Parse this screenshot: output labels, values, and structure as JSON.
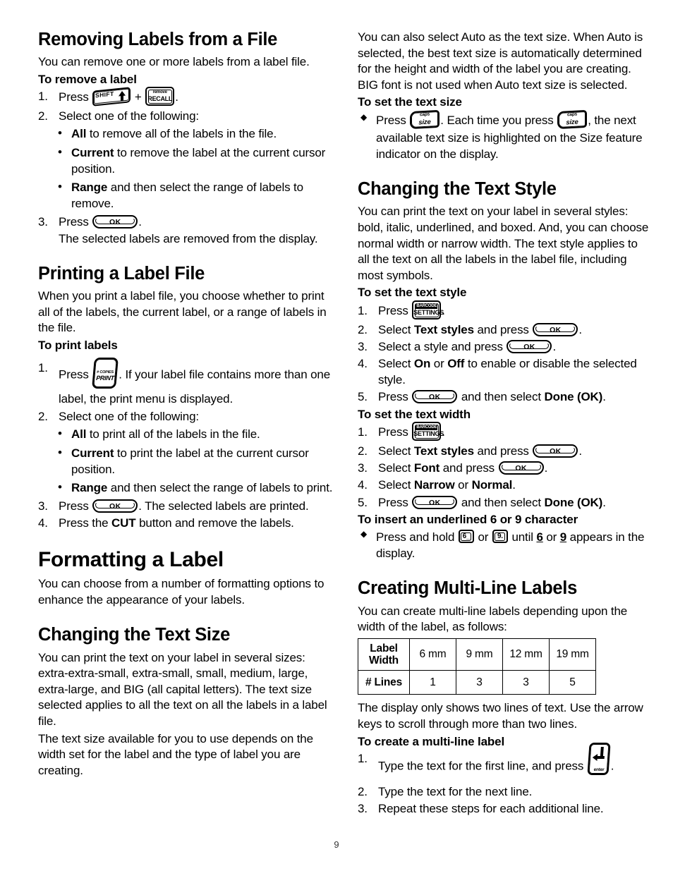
{
  "page": {
    "number": "9"
  },
  "keys": {
    "shift": {
      "label": "SHIFT",
      "arrow": "up-arrow"
    },
    "recall": {
      "top": "remove",
      "bottom": "RECALL"
    },
    "ok": {
      "label": "OK"
    },
    "print": {
      "top": "# COPIES",
      "bottom": "PRINT"
    },
    "size": {
      "top": "caps",
      "bottom": "size"
    },
    "settings": {
      "top": "BARCODE",
      "bottom": "SETTINGS"
    },
    "six": {
      "label": "6_"
    },
    "nine": {
      "label": "9."
    },
    "enter": {
      "label": "enter"
    }
  },
  "left_column": {
    "section_removing": {
      "heading": "Removing Labels from a File",
      "intro": "You can remove one or more labels from a label file.",
      "procedure_heading": "To remove a label",
      "step1_prefix": "Press",
      "step1_plus": "+",
      "step1_suffix": ".",
      "step2": "Select one of the following:",
      "bullets": [
        {
          "bold": "All",
          "rest": " to remove all of the labels in the file."
        },
        {
          "bold": "Current",
          "rest": " to remove the label at the current cursor position."
        },
        {
          "bold": "Range",
          "rest": " and then select the range of labels to remove."
        }
      ],
      "step3_prefix": "Press",
      "step3_suffix": ".",
      "step3_note": "The selected labels are removed from the display."
    },
    "section_printing": {
      "heading": "Printing a Label File",
      "intro": "When you print a label file, you choose whether to print all of the labels, the current label, or a range of labels in the file.",
      "procedure_heading": "To print labels",
      "step1_prefix": "Press",
      "step1_suffix": ". If your label file contains more than one label, the print menu is displayed.",
      "step2": "Select one of the following:",
      "bullets": [
        {
          "bold": "All",
          "rest": " to print all of the labels in the file."
        },
        {
          "bold": "Current",
          "rest": " to print the label at the current cursor position."
        },
        {
          "bold": "Range",
          "rest": " and then select the range of labels to print."
        }
      ],
      "step3_prefix": "Press",
      "step3_suffix": ". The selected labels are printed.",
      "step4_prefix": "Press the ",
      "step4_bold": "CUT",
      "step4_suffix": " button and remove the labels."
    },
    "section_formatting": {
      "heading": "Formatting a Label",
      "intro": "You can choose from a number of formatting options to enhance the appearance of your labels."
    },
    "section_text_size": {
      "heading": "Changing the Text Size",
      "para1": "You can print the text on your label in several sizes: extra-extra-small, extra-small, small, medium, large, extra-large, and BIG (all capital letters). The text size selected applies to all the text on all the labels in a label file.",
      "para2": "The text size available for you to use depends on the width set for the label and the type of label you are creating."
    }
  },
  "right_column": {
    "text_size_cont": {
      "para1": "You can also select Auto as the text size. When Auto is selected, the best text size is automatically determined for the height and width of the label you are creating. BIG font is not used when Auto text size is selected.",
      "procedure_heading": "To set the text size",
      "bullet_part1": "Press",
      "bullet_part2": ". Each time you press",
      "bullet_part3": ", the next available text size is highlighted on the Size feature indicator on the display."
    },
    "section_text_style": {
      "heading": "Changing the Text Style",
      "intro": "You can print the text on your label in several styles: bold, italic, underlined, and boxed. And, you can choose normal width or narrow width. The text style applies to all the text on all the labels in the label file, including most symbols.",
      "procedure_heading": "To set the text style",
      "step1_prefix": "Press",
      "step1_suffix": ".",
      "step2_prefix": "Select ",
      "step2_bold": "Text styles",
      "step2_mid": " and press ",
      "step2_suffix": ".",
      "step3_prefix": "Select a style and press ",
      "step3_suffix": ".",
      "step4_prefix": "Select ",
      "step4_bold1": "On",
      "step4_mid": " or ",
      "step4_bold2": "Off",
      "step4_suffix": " to enable or disable the selected style.",
      "step5_prefix": "Press ",
      "step5_mid": " and then select ",
      "step5_bold": "Done (OK)",
      "step5_suffix": "."
    },
    "section_text_width": {
      "procedure_heading": "To set the text width",
      "step1_prefix": "Press",
      "step1_suffix": ".",
      "step2_prefix": "Select ",
      "step2_bold": "Text styles",
      "step2_mid": " and press ",
      "step2_suffix": ".",
      "step3_prefix": "Select ",
      "step3_bold": "Font",
      "step3_mid": " and press ",
      "step3_suffix": ".",
      "step4_prefix": "Select ",
      "step4_bold1": "Narrow",
      "step4_mid": " or ",
      "step4_bold2": "Normal",
      "step4_suffix": ".",
      "step5_prefix": "Press ",
      "step5_mid": " and then select ",
      "step5_bold": "Done (OK)",
      "step5_suffix": "."
    },
    "section_underlined": {
      "procedure_heading": "To insert an underlined 6 or 9 character",
      "bullet_part1": "Press and hold",
      "bullet_part2": "or",
      "bullet_part3": "until",
      "bullet_bold1": "6",
      "bullet_mid": "or",
      "bullet_bold2": "9",
      "bullet_part4": "appears in the display."
    },
    "section_multiline": {
      "heading": "Creating Multi-Line Labels",
      "intro": "You can create multi-line labels depending upon the width of the label, as follows:",
      "table": {
        "row_headers": [
          "Label Width",
          "# Lines"
        ],
        "label_width_line1": "Label",
        "label_width_line2": "Width",
        "widths": [
          "6 mm",
          "9 mm",
          "12 mm",
          "19 mm"
        ],
        "lines": [
          "1",
          "3",
          "3",
          "5"
        ]
      },
      "note": "The display only shows two lines of text. Use the arrow keys to scroll through more than two lines.",
      "procedure_heading": "To create a multi-line label",
      "step1_prefix": "Type the text for the first line, and press",
      "step1_suffix": ".",
      "step2": "Type the text for the next line.",
      "step3": "Repeat these steps for each additional line."
    }
  }
}
